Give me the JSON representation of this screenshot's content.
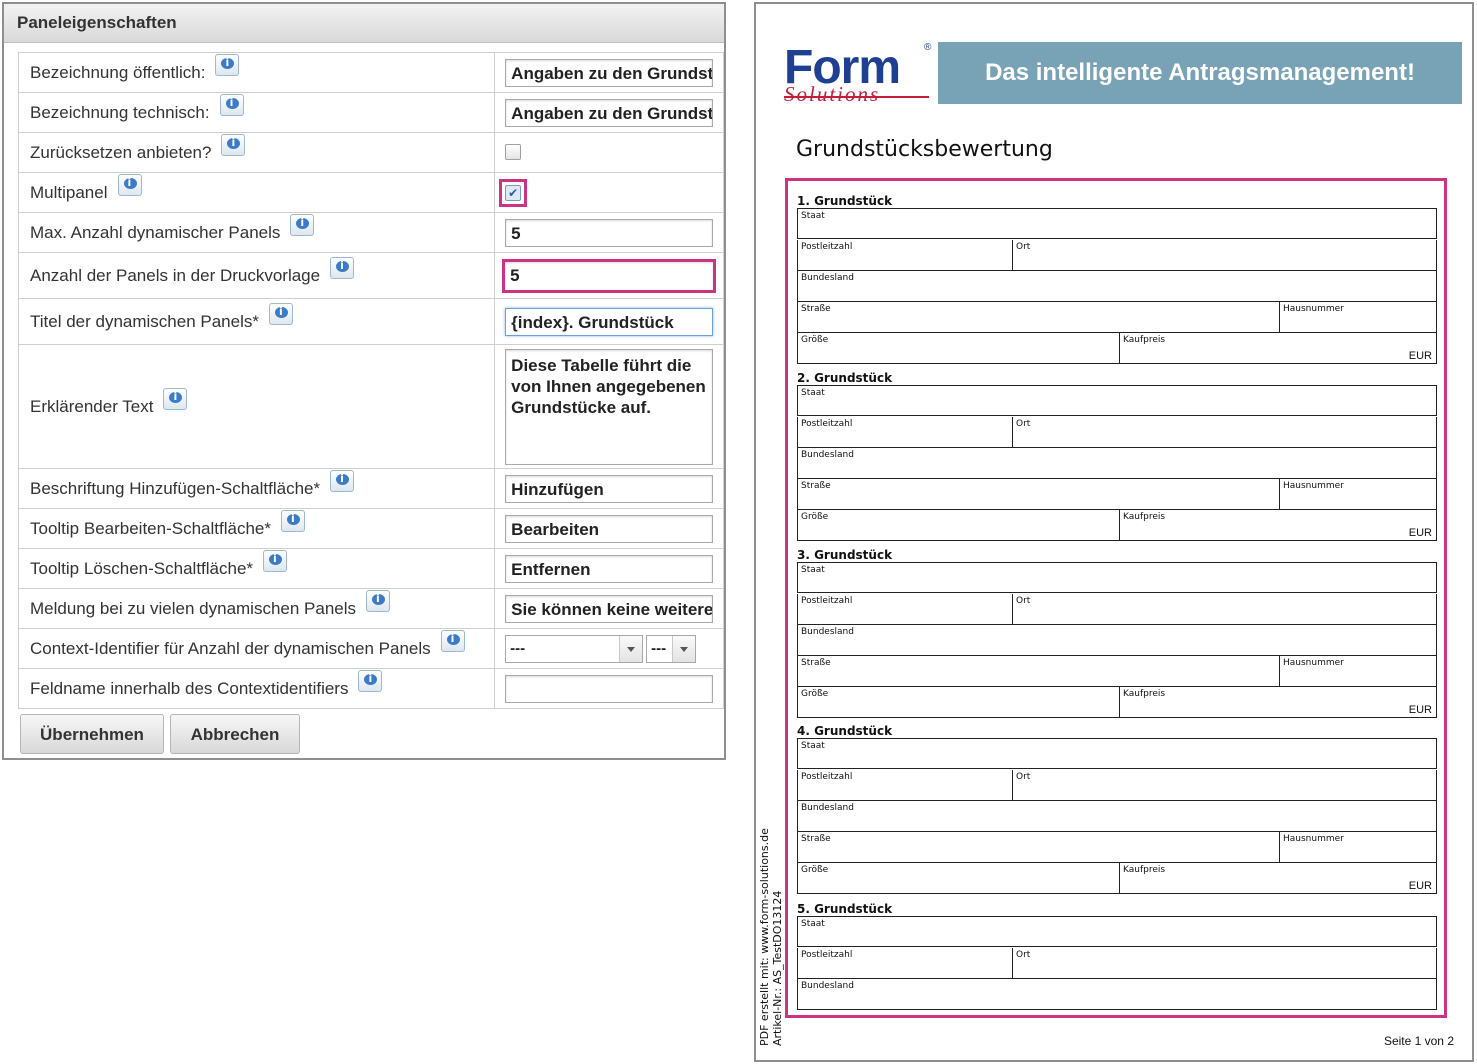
{
  "panel": {
    "title": "Paneleigenschaften",
    "rows": [
      {
        "label": "Bezeichnung öffentlich:",
        "value": "Angaben zu den Grundstücken"
      },
      {
        "label": "Bezeichnung technisch:",
        "value": "Angaben zu den Grundstücken"
      },
      {
        "label": "Zurücksetzen anbieten?",
        "checked": false
      },
      {
        "label": "Multipanel",
        "checked": true
      },
      {
        "label": "Max. Anzahl dynamischer Panels",
        "value": "5"
      },
      {
        "label": "Anzahl der Panels in der Druckvorlage",
        "value": "5"
      },
      {
        "label": "Titel der dynamischen Panels*",
        "value": "{index}. Grundstück"
      },
      {
        "label": "Erklärender Text",
        "value": "Diese Tabelle führt die von Ihnen angegebenen Grundstücke auf."
      },
      {
        "label": "Beschriftung Hinzufügen-Schaltfläche*",
        "value": "Hinzufügen"
      },
      {
        "label": "Tooltip Bearbeiten-Schaltfläche*",
        "value": "Bearbeiten"
      },
      {
        "label": "Tooltip Löschen-Schaltfläche*",
        "value": "Entfernen"
      },
      {
        "label": "Meldung bei zu vielen dynamischen Panels",
        "value": "Sie können keine weiteren"
      },
      {
        "label": "Context-Identifier für Anzahl der dynamischen Panels",
        "select1": "---",
        "select2": "---"
      },
      {
        "label": "Feldname innerhalb des Contextidentifiers",
        "value": ""
      }
    ],
    "buttons": {
      "apply": "Übernehmen",
      "cancel": "Abbrechen"
    }
  },
  "pdf": {
    "logo_main": "Form",
    "logo_sub": "Solutions",
    "logo_reg": "®",
    "banner": "Das intelligente Antragsmanagement!",
    "title": "Grundstücksbewertung",
    "sections": [
      "1. Grundstück",
      "2. Grundstück",
      "3. Grundstück",
      "4. Grundstück",
      "5. Grundstück"
    ],
    "fields": {
      "staat": "Staat",
      "plz": "Postleitzahl",
      "ort": "Ort",
      "bundesland": "Bundesland",
      "strasse": "Straße",
      "hausnummer": "Hausnummer",
      "groesse": "Größe",
      "kaufpreis": "Kaufpreis",
      "currency": "EUR"
    },
    "side_line1": "PDF erstellt mit: www.form-solutions.de",
    "side_line2": "Artikel-Nr.: AS_TestDO13124",
    "page": "Seite 1 von 2"
  },
  "colors": {
    "highlight": "#cc3380",
    "banner": "#78a2b6",
    "logo_blue": "#1f3f93",
    "logo_red": "#c41e3a"
  }
}
